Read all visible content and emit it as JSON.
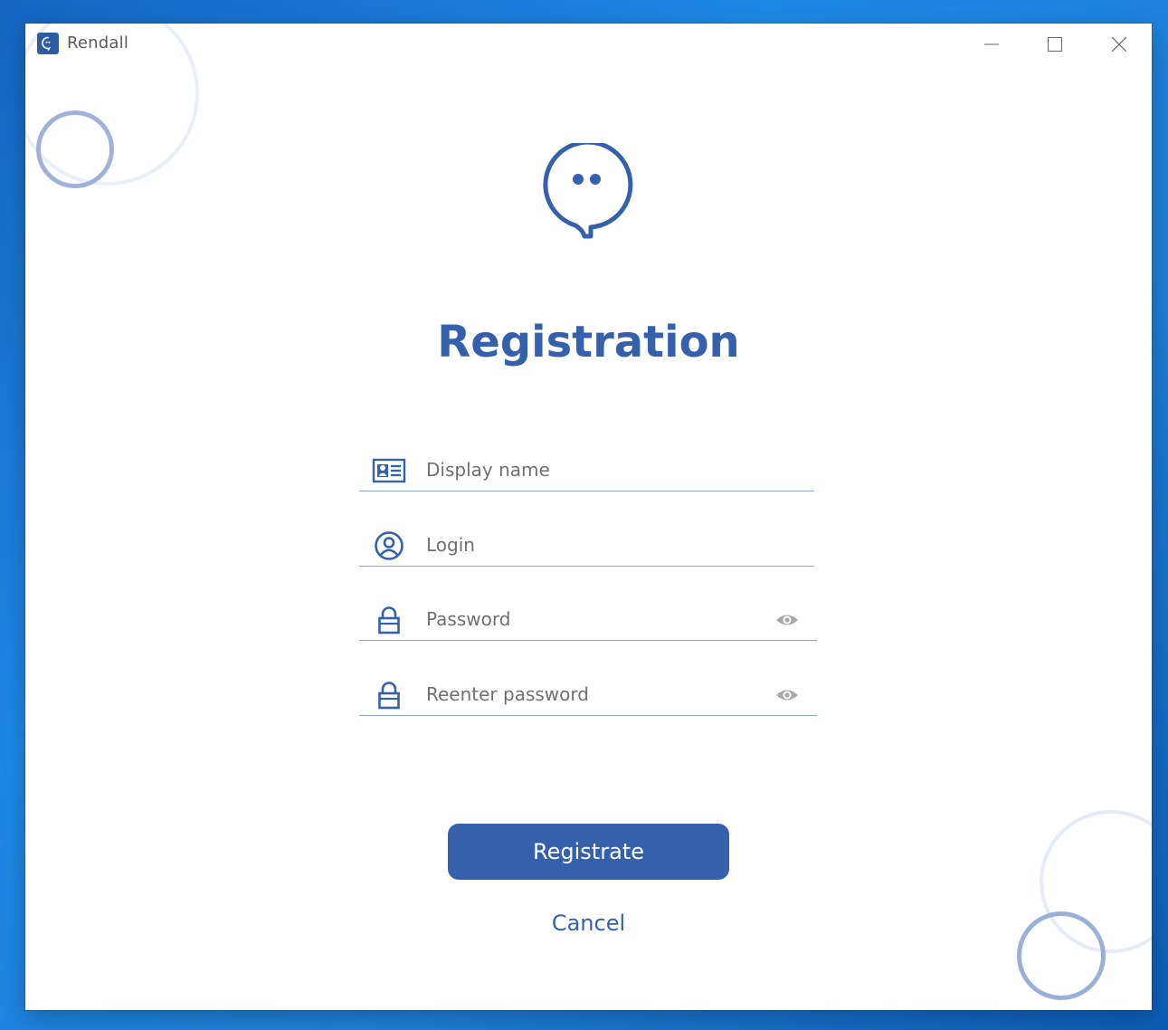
{
  "window": {
    "app_title": "Rendall",
    "app_icon": "chat-bubble-icon",
    "controls": {
      "minimize": "minimize-icon",
      "maximize": "maximize-icon",
      "close": "close-icon"
    }
  },
  "header": {
    "logo_icon": "chat-bubble-logo-icon",
    "title": "Registration"
  },
  "form": {
    "display_name": {
      "icon": "id-card-icon",
      "placeholder": "Display name",
      "value": ""
    },
    "login": {
      "icon": "user-circle-icon",
      "placeholder": "Login",
      "value": ""
    },
    "password": {
      "icon": "lock-icon",
      "placeholder": "Password",
      "value": "",
      "toggle_icon": "eye-icon"
    },
    "reenter_password": {
      "icon": "lock-icon",
      "placeholder": "Reenter password",
      "value": "",
      "toggle_icon": "eye-icon"
    }
  },
  "actions": {
    "submit_label": "Registrate",
    "cancel_label": "Cancel"
  },
  "colors": {
    "accent": "#3560ab",
    "field_line": "#8aa6d6",
    "deco_ring": "#9fb3d8",
    "eye_icon": "#9e9e9e"
  }
}
